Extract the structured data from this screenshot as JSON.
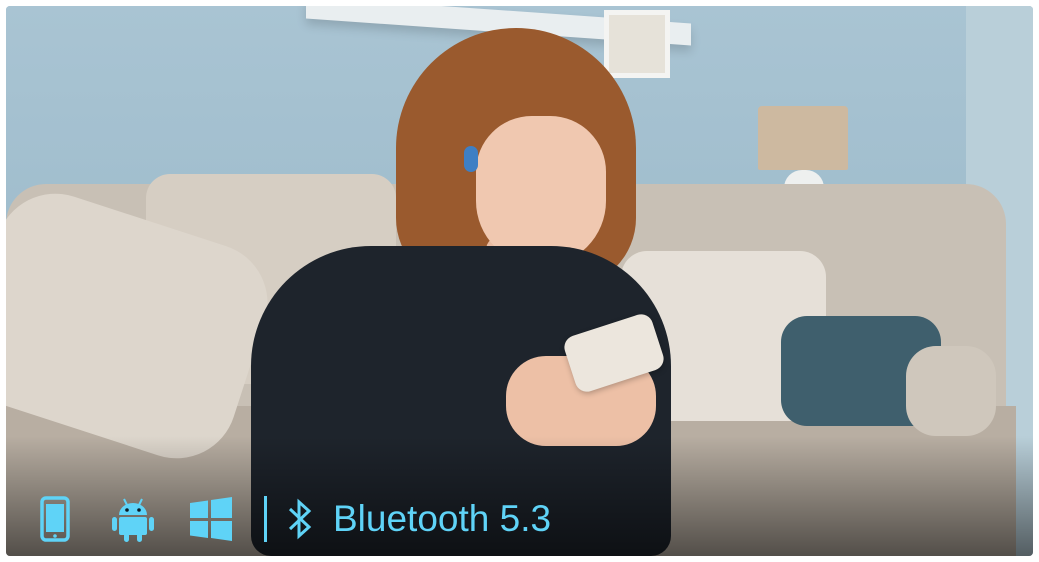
{
  "feature_bar": {
    "icons": [
      "smartphone-icon",
      "android-icon",
      "windows-icon",
      "bluetooth-icon"
    ],
    "bluetooth_label": "Bluetooth 5.3",
    "accent_color": "#5fd3f7"
  }
}
